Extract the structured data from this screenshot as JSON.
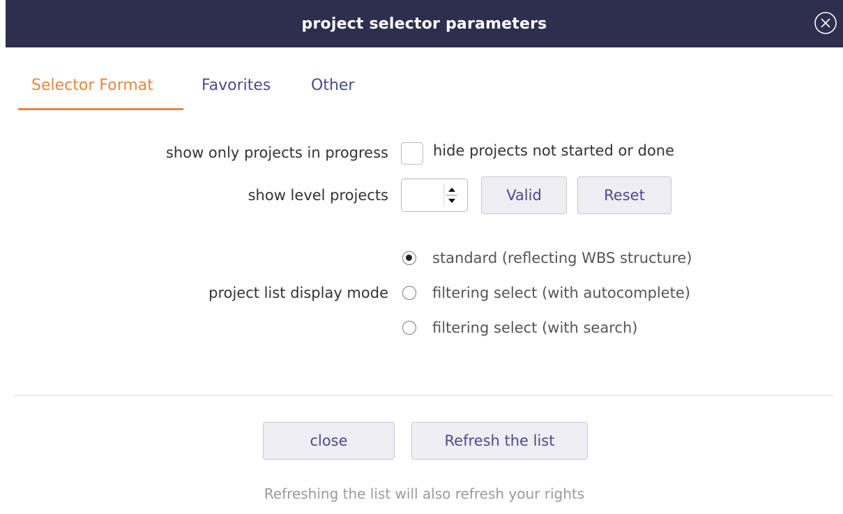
{
  "dialog": {
    "title": "project selector parameters"
  },
  "tabs": [
    {
      "label": "Selector Format",
      "active": true
    },
    {
      "label": "Favorites",
      "active": false
    },
    {
      "label": "Other",
      "active": false
    }
  ],
  "form": {
    "in_progress": {
      "label": "show only projects in progress",
      "checkbox_label": "hide projects not started or done",
      "checked": false
    },
    "level": {
      "label": "show level projects",
      "value": "",
      "valid_label": "Valid",
      "reset_label": "Reset"
    },
    "display_mode": {
      "label": "project list display mode",
      "options": [
        {
          "label": "standard (reflecting WBS structure)",
          "selected": true
        },
        {
          "label": "filtering select (with autocomplete)",
          "selected": false
        },
        {
          "label": "filtering select (with search)",
          "selected": false
        }
      ]
    }
  },
  "footer": {
    "close_label": "close",
    "refresh_label": "Refresh the list",
    "note": "Refreshing the list will also refresh your rights"
  },
  "colors": {
    "titlebar": "#2e2e4e",
    "accent": "#e8863a",
    "link": "#4b4b8c"
  }
}
